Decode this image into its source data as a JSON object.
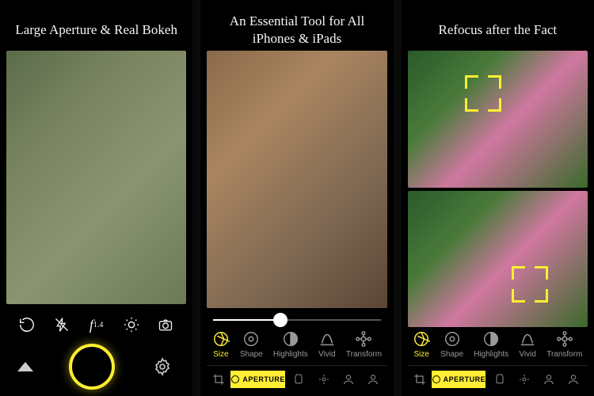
{
  "panels": [
    {
      "title": "Large Aperture & Real Bokeh",
      "camera": {
        "aperture_label": "f",
        "aperture_value": "1.4"
      }
    },
    {
      "title": "An Essential Tool for All iPhones & iPads",
      "tools": [
        {
          "label": "Size"
        },
        {
          "label": "Shape"
        },
        {
          "label": "Highlights"
        },
        {
          "label": "Vivid"
        },
        {
          "label": "Transform"
        }
      ],
      "bottom_active": "APERTURE"
    },
    {
      "title": "Refocus after the Fact",
      "tools": [
        {
          "label": "Size"
        },
        {
          "label": "Shape"
        },
        {
          "label": "Highlights"
        },
        {
          "label": "Vivid"
        },
        {
          "label": "Transform"
        }
      ],
      "bottom_active": "APERTURE"
    }
  ]
}
